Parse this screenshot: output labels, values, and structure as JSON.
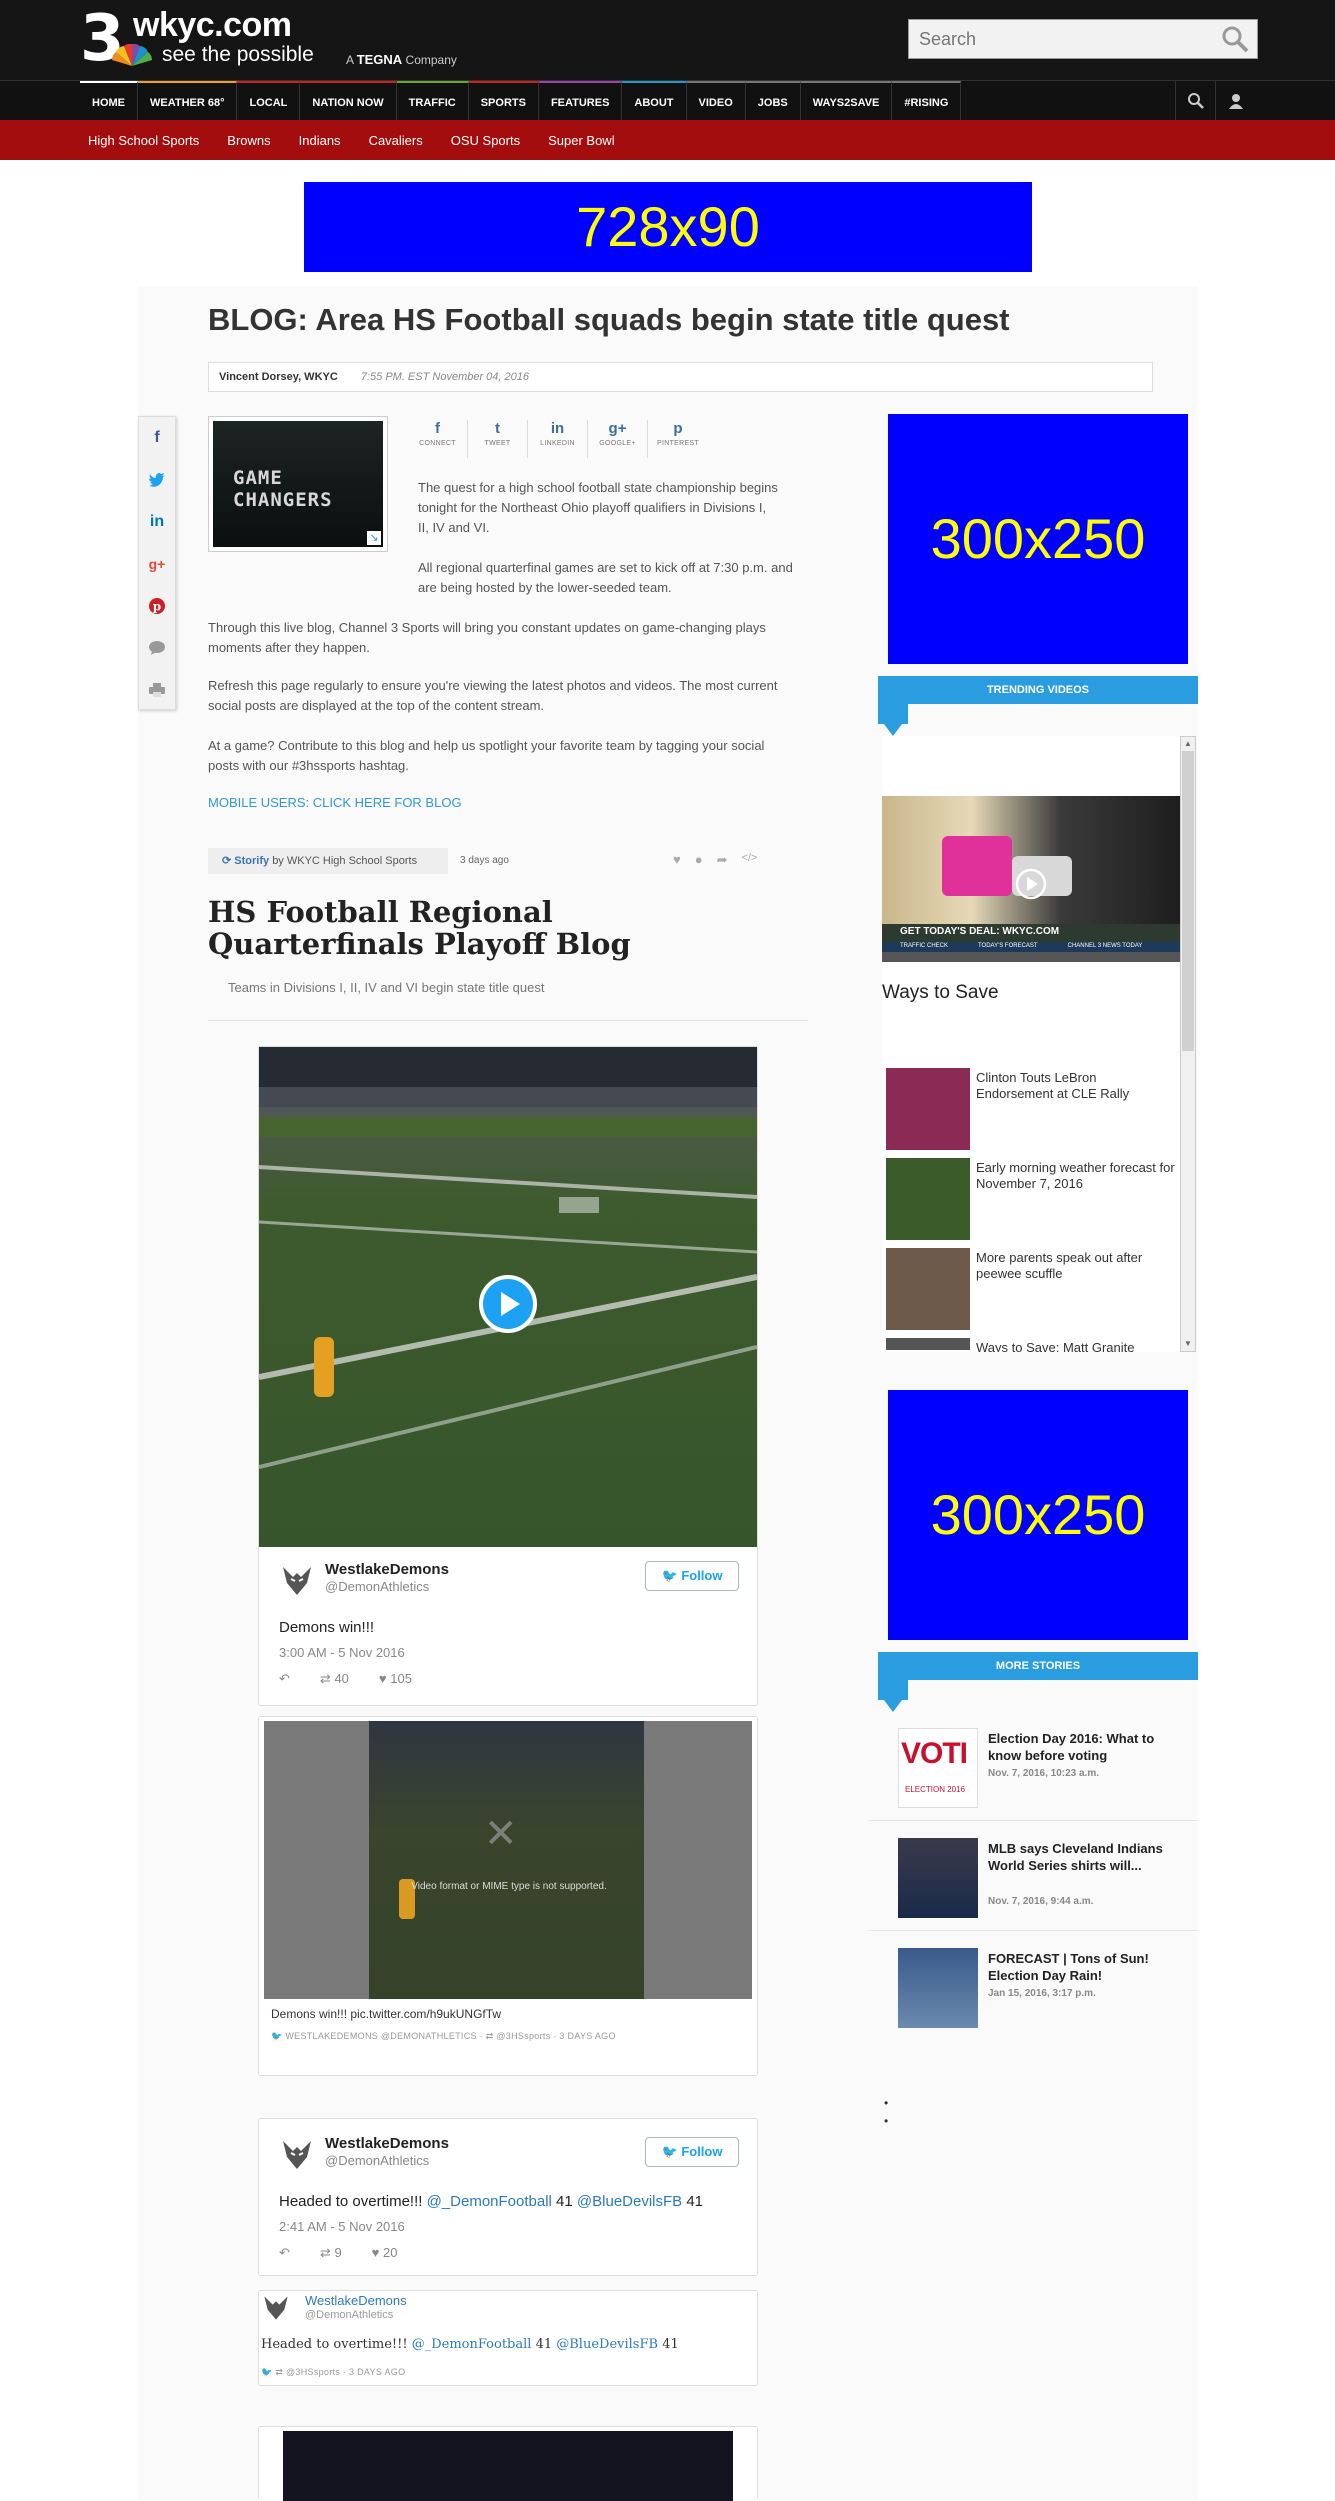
{
  "header": {
    "logo_number": "3",
    "site": "wkyc.com",
    "tagline": "see the possible",
    "tegna_prefix": "A",
    "tegna_brand": "TEGNA",
    "tegna_suffix": "Company",
    "search_placeholder": "Search"
  },
  "nav": {
    "items": [
      {
        "label": "HOME",
        "accent": "#ffffff"
      },
      {
        "label": "WEATHER 68°",
        "accent": "#f0a030"
      },
      {
        "label": "LOCAL",
        "accent": "#cc2222"
      },
      {
        "label": "NATION NOW",
        "accent": "#cc2222"
      },
      {
        "label": "TRAFFIC",
        "accent": "#66aa33"
      },
      {
        "label": "SPORTS",
        "accent": "#cc2222"
      },
      {
        "label": "FEATURES",
        "accent": "#9944aa"
      },
      {
        "label": "ABOUT",
        "accent": "#2299cc"
      },
      {
        "label": "VIDEO",
        "accent": "#777777"
      },
      {
        "label": "JOBS",
        "accent": "#777777"
      },
      {
        "label": "WAYS2SAVE",
        "accent": "#777777"
      },
      {
        "label": "#RISING",
        "accent": "#777777"
      }
    ]
  },
  "subnav": {
    "items": [
      "High School Sports",
      "Browns",
      "Indians",
      "Cavaliers",
      "OSU Sports",
      "Super Bowl"
    ]
  },
  "ads": {
    "leader": "728x90",
    "box1": "300x250",
    "box2": "300x250"
  },
  "article": {
    "title": "BLOG: Area HS Football squads begin state title quest",
    "author": "Vincent Dorsey, WKYC",
    "date": "7:55 PM. EST November 04, 2016",
    "thumb_text": "GAME CHANGERS",
    "share": [
      {
        "icon": "f",
        "label": "CONNECT"
      },
      {
        "icon": "t",
        "label": "TWEET"
      },
      {
        "icon": "in",
        "label": "LINKEDIN"
      },
      {
        "icon": "g+",
        "label": "GOOGLE+"
      },
      {
        "icon": "p",
        "label": "PINTEREST"
      }
    ],
    "p1": "The quest for a high school football state championship begins tonight for the Northeast Ohio playoff qualifiers in Divisions I, II, IV and VI.",
    "p2": "All regional quarterfinal games are set to kick off at 7:30 p.m. and are being hosted by the lower-seeded team.",
    "p3": "Through this live blog, Channel 3 Sports will bring you constant updates on game-changing plays moments after they happen.",
    "p4": "Refresh this page regularly to ensure you're viewing the latest photos and videos. The most current social posts are displayed at the top of the content stream.",
    "p5": "At a game? Contribute to this blog and help us spotlight your favorite team by tagging your social posts with our #3hssports hashtag.",
    "mobile_link": "MOBILE USERS: CLICK HERE FOR BLOG"
  },
  "storify": {
    "brand": "Storify",
    "by": "by WKYC High School Sports",
    "ago": "3 days ago",
    "title": "HS Football Regional Quarterfinals Playoff Blog",
    "subtitle": "Teams in Divisions I, II, IV and VI begin state title quest"
  },
  "tweet1": {
    "name": "WestlakeDemons",
    "handle": "@DemonAthletics",
    "follow": "Follow",
    "text": "Demons win!!!",
    "time": "3:00 AM - 5 Nov 2016",
    "retweets": "40",
    "likes": "105"
  },
  "embed1": {
    "error": "Video format or MIME type is not supported.",
    "text": "Demons win!!! pic.twitter.com/h9ukUNGfTw",
    "meta": "WESTLAKEDEMONS @DEMONATHLETICS · ⇄ @3HSsports · 3 DAYS AGO"
  },
  "tweet2": {
    "name": "WestlakeDemons",
    "handle": "@DemonAthletics",
    "follow": "Follow",
    "text_a": "Headed to overtime!!! ",
    "mention1": "@_DemonFootball",
    "text_b": " 41 ",
    "mention2": "@BlueDevilsFB",
    "text_c": " 41",
    "time": "2:41 AM - 5 Nov 2016",
    "retweets": "9",
    "likes": "20"
  },
  "embed2": {
    "name": "WestlakeDemons",
    "handle": "@DemonAthletics",
    "text_a": "Headed to overtime!!! ",
    "mention1": "@_DemonFootball",
    "text_b": " 41 ",
    "mention2": "@BlueDevilsFB",
    "text_c": " 41",
    "meta": "⇄ @3HSsports · 3 DAYS AGO"
  },
  "sidebar": {
    "trending_label": "TRENDING VIDEOS",
    "featured_caption": "GET TODAY'S DEAL: WKYC.COM",
    "featured_ticker": [
      "TRAFFIC CHECK",
      "TODAY'S FORECAST",
      "CHANNEL 3 NEWS TODAY"
    ],
    "featured_title": "Ways to Save",
    "videos": [
      {
        "title": "Clinton Touts LeBron Endorsement at CLE Rally",
        "color": "#8a2a55"
      },
      {
        "title": "Early morning weather forecast for November 7, 2016",
        "color": "#3b5a2a"
      },
      {
        "title": "More parents speak out after peewee scuffle",
        "color": "#6d5a4a"
      },
      {
        "title": "Ways to Save: Matt Granite",
        "color": "#555555"
      }
    ],
    "more_label": "MORE STORIES",
    "stories": [
      {
        "title": "Election Day 2016: What to know before voting",
        "date": "Nov. 7, 2016, 10:23 a.m.",
        "img_text": "VOTI",
        "img_sub": "ELECTION 2016"
      },
      {
        "title": "MLB says Cleveland Indians World Series shirts will...",
        "date": "Nov. 7, 2016, 9:44 a.m."
      },
      {
        "title": "FORECAST | Tons of Sun! Election Day Rain!",
        "date": "Jan 15, 2016, 3:17 p.m."
      }
    ]
  }
}
